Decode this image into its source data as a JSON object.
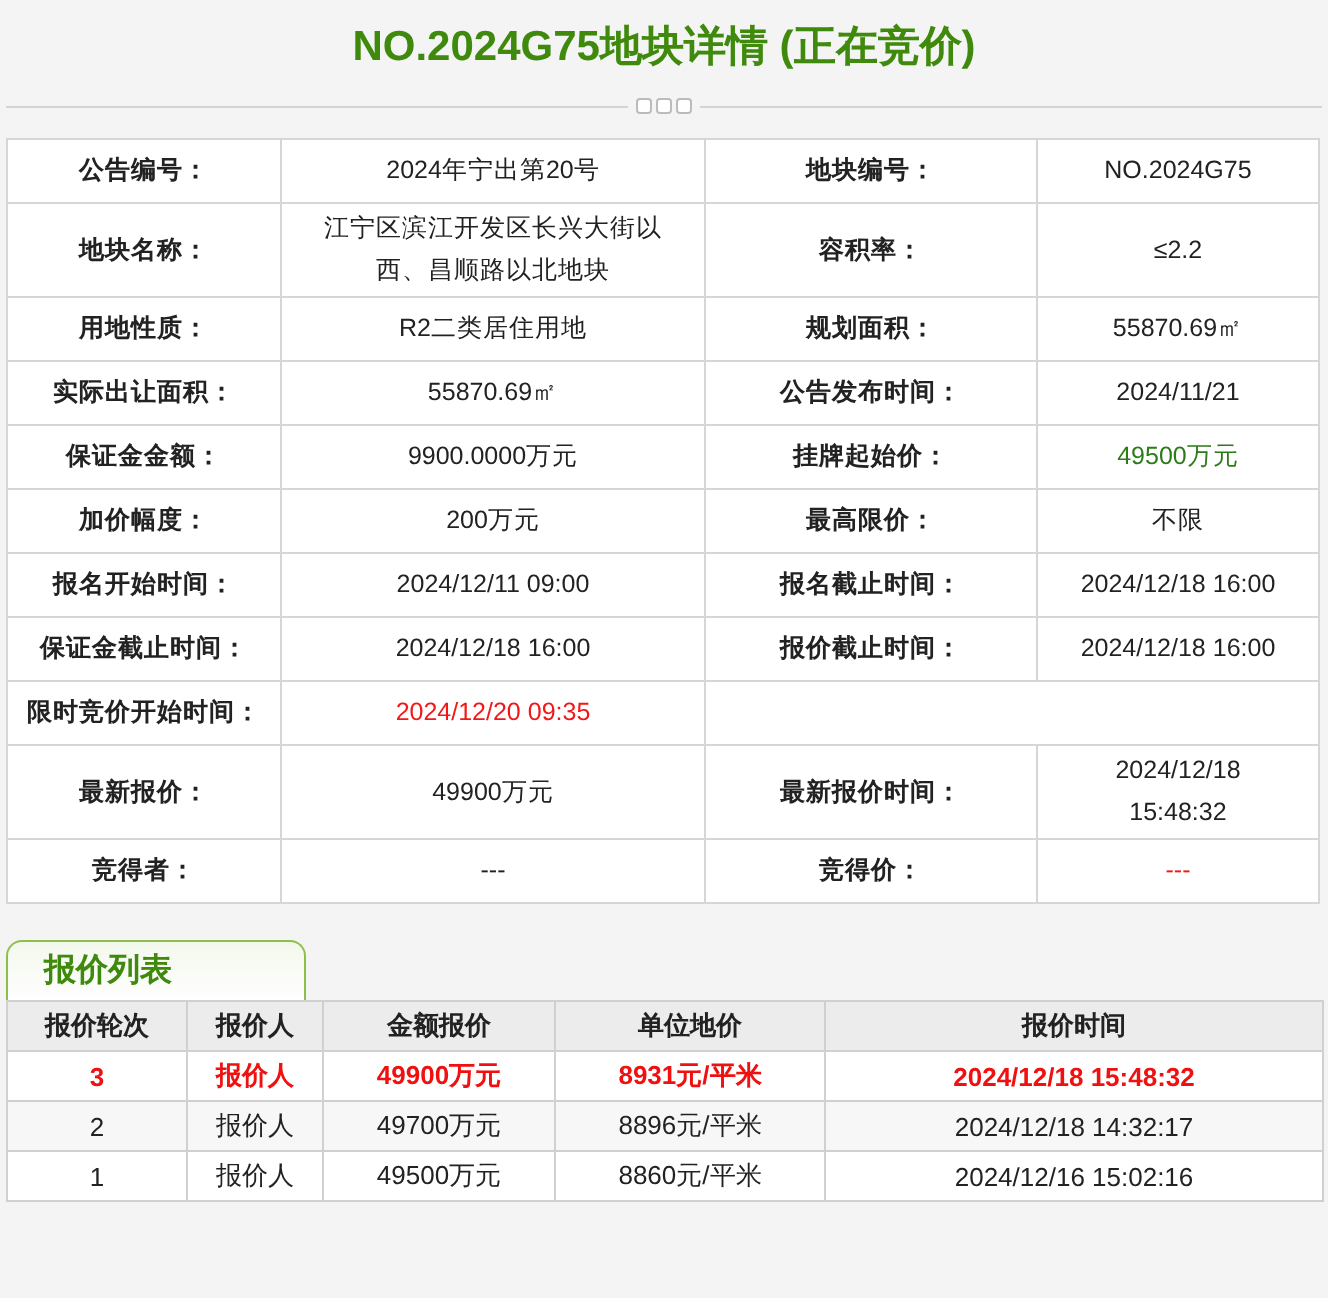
{
  "title": "NO.2024G75地块详情 (正在竞价)",
  "details": [
    [
      {
        "label": "公告编号：",
        "value": "2024年宁出第20号",
        "color": "#222222"
      },
      {
        "label": "地块编号：",
        "value": "NO.2024G75",
        "color": "#222222"
      }
    ],
    [
      {
        "label": "地块名称：",
        "value": "江宁区滨江开发区长兴大街以西、昌顺路以北地块",
        "color": "#222222"
      },
      {
        "label": "容积率：",
        "value": "≤2.2",
        "color": "#222222"
      }
    ],
    [
      {
        "label": "用地性质：",
        "value": "R2二类居住用地",
        "color": "#222222"
      },
      {
        "label": "规划面积：",
        "value": "55870.69㎡",
        "color": "#222222"
      }
    ],
    [
      {
        "label": "实际出让面积：",
        "value": "55870.69㎡",
        "color": "#222222"
      },
      {
        "label": "公告发布时间：",
        "value": "2024/11/21",
        "color": "#222222"
      }
    ],
    [
      {
        "label": "保证金金额：",
        "value": "9900.0000万元",
        "color": "#222222"
      },
      {
        "label": "挂牌起始价：",
        "value": "49500万元",
        "color": "#2c7d1a"
      }
    ],
    [
      {
        "label": "加价幅度：",
        "value": "200万元",
        "color": "#222222"
      },
      {
        "label": "最高限价：",
        "value": "不限",
        "color": "#222222"
      }
    ],
    [
      {
        "label": "报名开始时间：",
        "value": "2024/12/11 09:00",
        "color": "#222222"
      },
      {
        "label": "报名截止时间：",
        "value": "2024/12/18 16:00",
        "color": "#222222"
      }
    ],
    [
      {
        "label": "保证金截止时间：",
        "value": "2024/12/18 16:00",
        "color": "#222222"
      },
      {
        "label": "报价截止时间：",
        "value": "2024/12/18 16:00",
        "color": "#222222"
      }
    ],
    [
      {
        "label": "限时竞价开始时间：",
        "value": "2024/12/20 09:35",
        "color": "#f01818"
      }
    ],
    [
      {
        "label": "最新报价：",
        "value": "49900万元",
        "color": "#222222"
      },
      {
        "label": "最新报价时间：",
        "value": "2024/12/18 15:48:32",
        "color": "#222222"
      }
    ],
    [
      {
        "label": "竞得者：",
        "value": "---",
        "color": "#222222"
      },
      {
        "label": "竞得价：",
        "value": "---",
        "color": "#f01818"
      }
    ]
  ],
  "bids_tab": "报价列表",
  "bids_columns": [
    "报价轮次",
    "报价人",
    "金额报价",
    "单位地价",
    "报价时间"
  ],
  "bids": [
    {
      "cells": [
        "3",
        "报价人",
        "49900万元",
        "8931元/平米",
        "2024/12/18 15:48:32"
      ],
      "highlighted": true
    },
    {
      "cells": [
        "2",
        "报价人",
        "49700万元",
        "8896元/平米",
        "2024/12/18 14:32:17"
      ],
      "highlighted": false
    },
    {
      "cells": [
        "1",
        "报价人",
        "49500万元",
        "8860元/平米",
        "2024/12/16 15:02:16"
      ],
      "highlighted": false
    }
  ]
}
